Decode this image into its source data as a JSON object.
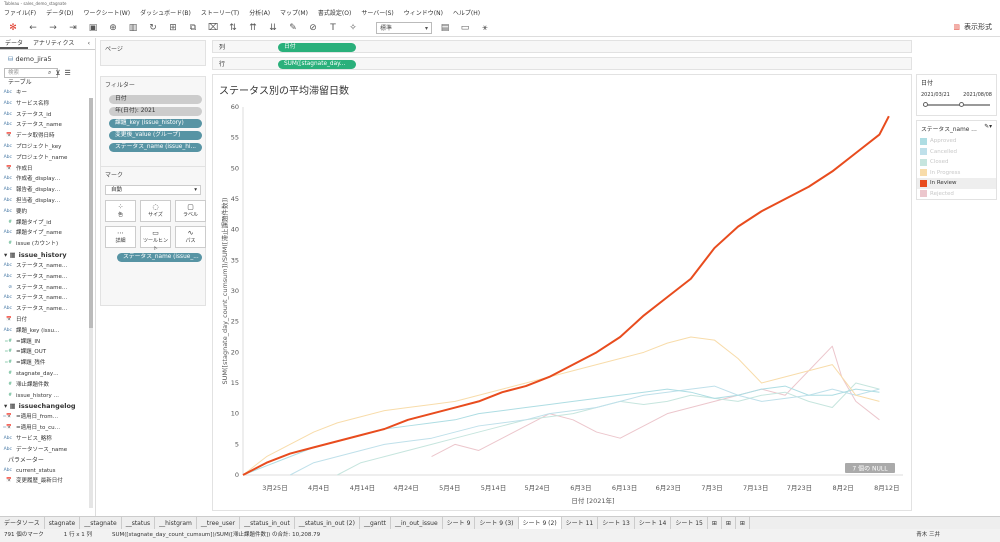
{
  "window": {
    "title": "Tableau - sales_demo_stagnate"
  },
  "menu": [
    "ファイル(F)",
    "データ(D)",
    "ワークシート(W)",
    "ダッシュボード(B)",
    "ストーリー(T)",
    "分析(A)",
    "マップ(M)",
    "書式設定(O)",
    "サーバー(S)",
    "ウィンドウ(N)",
    "ヘルプ(H)"
  ],
  "toolbar": {
    "fit": "標準",
    "show_me": "表示形式"
  },
  "left_panel": {
    "tab_data": "データ",
    "tab_analytics": "アナリティクス",
    "datasource": "demo_jira5",
    "search_placeholder": "検索",
    "tables_label": "テーブル",
    "fields1": [
      {
        "t": "Abc",
        "n": "キー"
      },
      {
        "t": "Abc",
        "n": "サービス名称"
      },
      {
        "t": "Abc",
        "n": "ステータス_id"
      },
      {
        "t": "Abc",
        "n": "ステータス_name"
      },
      {
        "t": "📅",
        "n": "データ取得日時"
      },
      {
        "t": "Abc",
        "n": "プロジェクト_key"
      },
      {
        "t": "Abc",
        "n": "プロジェクト_name"
      },
      {
        "t": "📅",
        "n": "作成日"
      },
      {
        "t": "Abc",
        "n": "作成者_display…"
      },
      {
        "t": "Abc",
        "n": "報告者_display…"
      },
      {
        "t": "Abc",
        "n": "担当者_display…"
      },
      {
        "t": "Abc",
        "n": "要約"
      },
      {
        "t": "#",
        "n": "課題タイプ_id"
      },
      {
        "t": "Abc",
        "n": "課題タイプ_name"
      },
      {
        "t": "#",
        "n": "issue (カウント)"
      }
    ],
    "group2": "issue_history",
    "fields2": [
      {
        "t": "Abc",
        "n": "ステータス_name…"
      },
      {
        "t": "Abc",
        "n": "ステータス_name…"
      },
      {
        "t": "⊘",
        "n": "ステータス_name…"
      },
      {
        "t": "Abc",
        "n": "ステータス_name…"
      },
      {
        "t": "Abc",
        "n": "ステータス_name…"
      },
      {
        "t": "📅",
        "n": "日付"
      },
      {
        "t": "Abc",
        "n": "課題_key (issu…"
      },
      {
        "t": "=#",
        "n": "=課題_IN"
      },
      {
        "t": "=#",
        "n": "=課題_OUT"
      },
      {
        "t": "=#",
        "n": "=課題_残件"
      },
      {
        "t": "#",
        "n": "stagnate_day…"
      },
      {
        "t": "#",
        "n": "滞止課題件数"
      },
      {
        "t": "#",
        "n": "issue_history …"
      }
    ],
    "group3": "issuechangelog",
    "fields3": [
      {
        "t": "=📅",
        "n": "=適用日_from…"
      },
      {
        "t": "=📅",
        "n": "=適用日_to_cu…"
      },
      {
        "t": "Abc",
        "n": "サービス_略称"
      },
      {
        "t": "Abc",
        "n": "データソース_name"
      }
    ],
    "params_label": "パラメーター",
    "params": [
      {
        "t": "Abc",
        "n": "current_status"
      },
      {
        "t": "📅",
        "n": "変更履歴_最新日付"
      }
    ]
  },
  "pages": {
    "title": "ページ"
  },
  "filters": {
    "title": "フィルター",
    "items": [
      "日付",
      "年(日付): 2021",
      "課題_key (issue_history)",
      "変更後_value (グループ)",
      "ステータス_name (issue_hi..."
    ]
  },
  "marks": {
    "title": "マーク",
    "type": "自動",
    "buttons": [
      "色",
      "サイズ",
      "ラベル",
      "詳細",
      "ツールヒント",
      "パス"
    ],
    "color_pill": "ステータス_name (issue_..."
  },
  "shelves": {
    "columns_label": "列",
    "columns_pill": "日付",
    "rows_label": "行",
    "rows_pill": "SUM([stagnate_day..."
  },
  "view": {
    "title": "ステータス別の平均滞留日数",
    "null_badge": "7 個の NULL"
  },
  "right_panel": {
    "date_title": "日付",
    "date_from": "2021/03/21",
    "date_to": "2021/08/08",
    "legend_title": "ステータス_name …",
    "legend": [
      {
        "name": "Approved",
        "color": "#aedde3"
      },
      {
        "name": "Cancelled",
        "color": "#bfe0ea"
      },
      {
        "name": "Closed",
        "color": "#c6e5de"
      },
      {
        "name": "In Progress",
        "color": "#f8dcaa"
      },
      {
        "name": "In Review",
        "color": "#e84c1e"
      },
      {
        "name": "Rejected",
        "color": "#ecc6cc"
      }
    ]
  },
  "sheet_tabs": [
    "データソース",
    "stagnate",
    "__stagnate",
    "__status",
    "__histgram",
    "__tree_user",
    "__status_in_out",
    "__status_in_out (2)",
    "__gantt",
    "__in_out_issue",
    "シート 9",
    "シート 9 (3)",
    "シート 9 (2)",
    "シート 11",
    "シート 13",
    "シート 14",
    "シート 15"
  ],
  "selected_sheet": "シート 9 (2)",
  "status": {
    "marks": "791 個のマーク",
    "grid": "1 行 x 1 列",
    "sum": "SUM([stagnate_day_count_cumsum])/SUM([滞止課題件数]) の合計: 10,208.79",
    "user": "青木 三井"
  },
  "chart_data": {
    "type": "line",
    "title": "ステータス別の平均滞留日数",
    "xlabel": "日付 [2021年]",
    "ylabel": "SUM([stagnate_day_count_cumsum])/SUM([滞止課題件数])",
    "x_ticks": [
      "3月25日",
      "4月4日",
      "4月14日",
      "4月24日",
      "5月4日",
      "5月14日",
      "5月24日",
      "6月3日",
      "6月13日",
      "6月23日",
      "7月3日",
      "7月13日",
      "7月23日",
      "8月2日",
      "8月12日"
    ],
    "ylim": [
      0,
      60
    ],
    "y_ticks": [
      0,
      5,
      10,
      15,
      20,
      25,
      30,
      35,
      40,
      45,
      50,
      55,
      60
    ],
    "series": [
      {
        "name": "In Review",
        "color": "#e84c1e",
        "width": 2,
        "x": [
          0,
          5,
          10,
          15,
          20,
          25,
          30,
          35,
          40,
          45,
          50,
          55,
          60,
          65,
          70,
          75,
          80,
          85,
          90,
          95,
          100,
          105,
          110,
          115,
          120,
          125,
          130,
          135,
          137
        ],
        "y": [
          0,
          2,
          3.5,
          4.5,
          5.5,
          6.5,
          7.5,
          9,
          10,
          11,
          12,
          13.5,
          14.5,
          16,
          18,
          20,
          22.5,
          26,
          29,
          32,
          37,
          40.5,
          43,
          45,
          47,
          49.5,
          52.5,
          55.5,
          58.5
        ]
      },
      {
        "name": "In Progress",
        "color": "#f8dcaa",
        "width": 1,
        "x": [
          0,
          5,
          10,
          15,
          20,
          25,
          30,
          35,
          40,
          45,
          50,
          55,
          60,
          65,
          70,
          75,
          80,
          85,
          90,
          95,
          100,
          105,
          110,
          115,
          120,
          125,
          130,
          135
        ],
        "y": [
          0,
          3,
          5,
          7,
          8.5,
          9.5,
          10.5,
          11,
          11.5,
          12,
          13,
          14,
          15,
          16,
          17,
          18,
          19,
          20,
          21.5,
          22.5,
          22,
          19,
          15,
          16,
          17,
          18,
          13,
          12
        ]
      },
      {
        "name": "Approved",
        "color": "#aedde3",
        "width": 1,
        "x": [
          0,
          5,
          10,
          15,
          20,
          25,
          30,
          35,
          40,
          45,
          50,
          55,
          60,
          65,
          70,
          75,
          80,
          85,
          90,
          95,
          100,
          105,
          110,
          115,
          120,
          125,
          130,
          135
        ],
        "y": [
          0,
          1.5,
          3,
          4.5,
          5.5,
          6.5,
          7.5,
          8,
          8.5,
          9,
          10,
          10.5,
          11,
          11.5,
          12,
          12.5,
          13,
          13.5,
          14,
          13.5,
          12.5,
          13,
          14,
          14.5,
          13,
          13,
          14,
          13.5
        ]
      },
      {
        "name": "Cancelled",
        "color": "#bfe0ea",
        "width": 1,
        "x": [
          10,
          15,
          20,
          25,
          30,
          35,
          40,
          45,
          50,
          55,
          60,
          65,
          70,
          75,
          80,
          85,
          90,
          95,
          100,
          105,
          110,
          115,
          120,
          125,
          130,
          135
        ],
        "y": [
          0,
          2,
          3,
          4,
          5,
          5.5,
          6,
          7,
          8,
          8.5,
          9,
          10,
          10.5,
          11,
          12,
          13,
          13.5,
          14,
          14.5,
          13,
          12,
          12.5,
          13,
          14,
          13,
          14
        ]
      },
      {
        "name": "Closed",
        "color": "#c6e5de",
        "width": 1,
        "x": [
          20,
          25,
          30,
          35,
          40,
          45,
          50,
          55,
          60,
          65,
          70,
          75,
          80,
          85,
          90,
          95,
          100,
          105,
          110,
          115,
          120,
          125,
          130,
          135
        ],
        "y": [
          0,
          2,
          3,
          4,
          5,
          6,
          7,
          8,
          9,
          9.5,
          10,
          11,
          12,
          11.5,
          12,
          13,
          12.5,
          12,
          13,
          13.5,
          12,
          11,
          15,
          14
        ]
      },
      {
        "name": "Rejected",
        "color": "#ecc6cc",
        "width": 1,
        "x": [
          40,
          45,
          50,
          55,
          60,
          65,
          70,
          75,
          80,
          85,
          90,
          95,
          100,
          105,
          110,
          115,
          120,
          125,
          127,
          130,
          135
        ],
        "y": [
          3,
          5,
          4,
          6,
          8,
          10,
          9,
          7,
          6,
          8,
          10,
          11,
          12,
          13,
          14,
          13,
          17,
          21,
          16,
          12,
          9
        ]
      }
    ]
  }
}
